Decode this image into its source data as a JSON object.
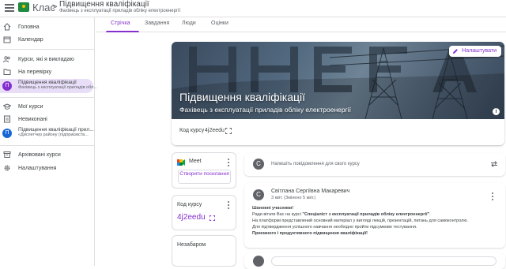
{
  "header": {
    "app_name": "Клас",
    "crumb_separator": ">",
    "course_title": "Підвищення кваліфікації",
    "course_subtitle": "Фахівець з експлуатації приладів обліку електроенергії"
  },
  "sidebar": {
    "items": [
      {
        "label": "Головна",
        "icon": "home-icon"
      },
      {
        "label": "Календар",
        "icon": "calendar-icon"
      },
      {
        "label": "Курси, які я викладаю",
        "icon": "people-icon"
      },
      {
        "label": "На перевірку",
        "icon": "review-folder-icon"
      }
    ],
    "teaching_courses": [
      {
        "initial": "П",
        "title": "Підвищення кваліфікації",
        "subtitle": "Фахівець з експлуатації приладів обл...",
        "color": "#8430ce"
      }
    ],
    "my_courses_label": "Мої курси",
    "todo_label": "Невиконані",
    "enrolled_courses": [
      {
        "initial": "П",
        "title": "Підвищення кваліфікації прил...",
        "subtitle": "«Диспетчер району (підприємств...",
        "color": "#1967d2"
      }
    ],
    "archived_label": "Архівовані курси",
    "settings_label": "Налаштування"
  },
  "tabs": {
    "items": [
      "Стрічка",
      "Завдання",
      "Люди",
      "Оцінки"
    ],
    "active": "Стрічка"
  },
  "banner": {
    "title": "Підвищення кваліфікації",
    "subtitle": "Фахівець з експлуатації приладів обліку електроенергії",
    "settings_label": "Налаштувати",
    "code_label": "Код курсу",
    "code_value": "4j2eedu",
    "info_glyph": "i"
  },
  "meet": {
    "label": "Meet",
    "create_button": "Створити посилання"
  },
  "code_card": {
    "title": "Код курсу",
    "value": "4j2eedu"
  },
  "upcoming": {
    "title": "Незабаром"
  },
  "post_box": {
    "avatar_initial": "С",
    "placeholder": "Напишіть повідомлення для свого курсу"
  },
  "announcement": {
    "avatar_initial": "С",
    "author": "Світлана Сергіївна Макаревич",
    "date": "3 квіт. (Змінено 5 квіт.)",
    "greeting": "Шановні учасники!",
    "line1_prefix": "Ради вітати Вас на курсі ",
    "line1_course": "\"Спеціаліст з експлуатації приладів обліку електроенергії\"",
    "line1_suffix": ".",
    "line2": "На платформі представлений основний матеріал у вигляді лекцій, презентацій, питань для самоконтролю.",
    "line3": "Для підтвердження успішного навчання необхідно пройти підсумкове тестування.",
    "closing": "Приємного і продуктивного підвищення кваліфікації!"
  },
  "colors": {
    "accent": "#8430ce",
    "active_bg": "#e8def8",
    "brand_green": "#1e8e3e"
  }
}
